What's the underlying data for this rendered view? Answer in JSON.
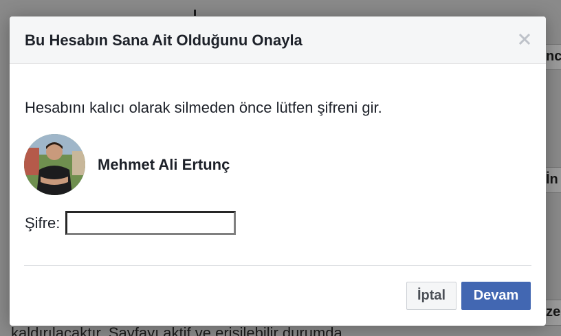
{
  "background": {
    "text_fragment": "kaldırılacaktır. Sayfayı aktif ve erişilebilir durumda",
    "button_fragment_1": "nc",
    "button_fragment_2": "İn",
    "button_fragment_3": "zer"
  },
  "dialog": {
    "title": "Bu Hesabın Sana Ait Olduğunu Onayla",
    "close_icon": "close-icon",
    "message": "Hesabını kalıcı olarak silmeden önce lütfen şifreni gir.",
    "user": {
      "name": "Mehmet Ali Ertunç",
      "avatar": "profile-photo"
    },
    "password": {
      "label": "Şifre:",
      "value": "",
      "placeholder": ""
    },
    "buttons": {
      "cancel_label": "İptal",
      "continue_label": "Devam"
    }
  },
  "colors": {
    "primary_button": "#4267b2",
    "header_bg": "#f5f6f7",
    "overlay": "#8a8a8a"
  }
}
